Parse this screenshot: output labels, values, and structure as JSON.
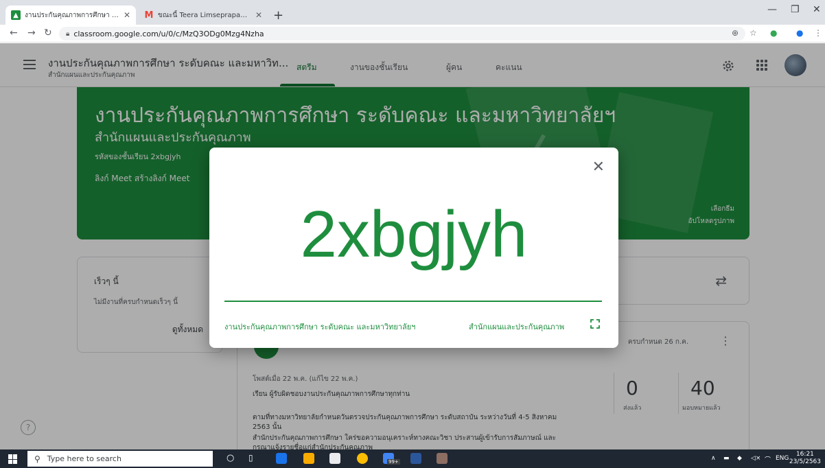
{
  "browser": {
    "tabs": [
      {
        "title": "งานประกันคุณภาพการศึกษา ระดับคณะ",
        "favicon_color": "#1e8e3e",
        "active": true
      },
      {
        "title": "ขณะนี้ Teera Limseprapan กำลังเขียน",
        "favicon_color": "#ea4335",
        "active": false
      }
    ],
    "new_tab": "+",
    "url": "classroom.google.com/u/0/c/MzQ3ODg0Mzg4Nzha"
  },
  "app": {
    "class_title": "งานประกันคุณภาพการศึกษา ระดับคณะ และมหาวิท...",
    "class_subtitle": "สำนักแผนและประกันคุณภาพ",
    "nav_tabs": [
      {
        "label": "สตรีม",
        "active": true
      },
      {
        "label": "งานของชั้นเรียน",
        "active": false
      },
      {
        "label": "ผู้คน",
        "active": false
      },
      {
        "label": "คะแนน",
        "active": false
      }
    ],
    "accent": "#137333"
  },
  "banner": {
    "title": "งานประกันคุณภาพการศึกษา ระดับคณะ และมหาวิทยาลัยฯ",
    "subtitle": "สำนักแผนและประกันคุณภาพ",
    "class_code_line": "รหัสของชั้นเรียน 2xbgjyh",
    "meet_line": "ลิงก์ Meet สร้างลิงก์ Meet",
    "select_theme": "เลือกธีม",
    "upload_photo": "อัปโหลดรูปภาพ",
    "color": "#1e8e3e"
  },
  "upcoming": {
    "heading": "เร็วๆ นี้",
    "empty_text": "ไม่มีงานที่ครบกำหนดเร็วๆ นี้",
    "view_all": "ดูทั้งหมด"
  },
  "post": {
    "due": "ครบกำหนด 26 ก.ค.",
    "posted": "โพสต์เมื่อ 22 พ.ค. (แก้ไข 22 พ.ค.)",
    "line1": "เรียน ผู้รับผิดชอบงานประกันคุณภาพการศึกษาทุกท่าน",
    "line2": "ตามที่ทางมหาวิทยาลัยกำหนดวันตรวจประกันคุณภาพการศึกษา ระดับสถาบัน ระหว่างวันที่ 4-5 สิงหาคม",
    "line3": "2563 นั้น",
    "line4": "สำนักประกันคุณภาพการศึกษา ใคร่ขอความอนุเคราะห์ทางคณะวิชา ประสานผู้เข้ารับการสัมภาษณ์ และ",
    "line5": "กรุณาแจ้งรายชื่อแก่สำนักประกันคุณภาพ",
    "submitted_count": "0",
    "submitted_label": "ส่งแล้ว",
    "assigned_count": "40",
    "assigned_label": "มอบหมายแล้ว"
  },
  "dialog": {
    "class_code": "2xbgjyh",
    "footer_class": "งานประกันคุณภาพการศึกษา ระดับคณะ และมหาวิทยาลัยฯ",
    "footer_section": "สำนักแผนและประกันคุณภาพ",
    "close": "✕"
  },
  "taskbar": {
    "search_placeholder": "Type here to search",
    "language": "ENG",
    "time": "16:21",
    "date": "23/5/2563",
    "badge": "99+"
  },
  "icons": {
    "help": "?",
    "swap": "⇄",
    "kebab": "⋮"
  }
}
